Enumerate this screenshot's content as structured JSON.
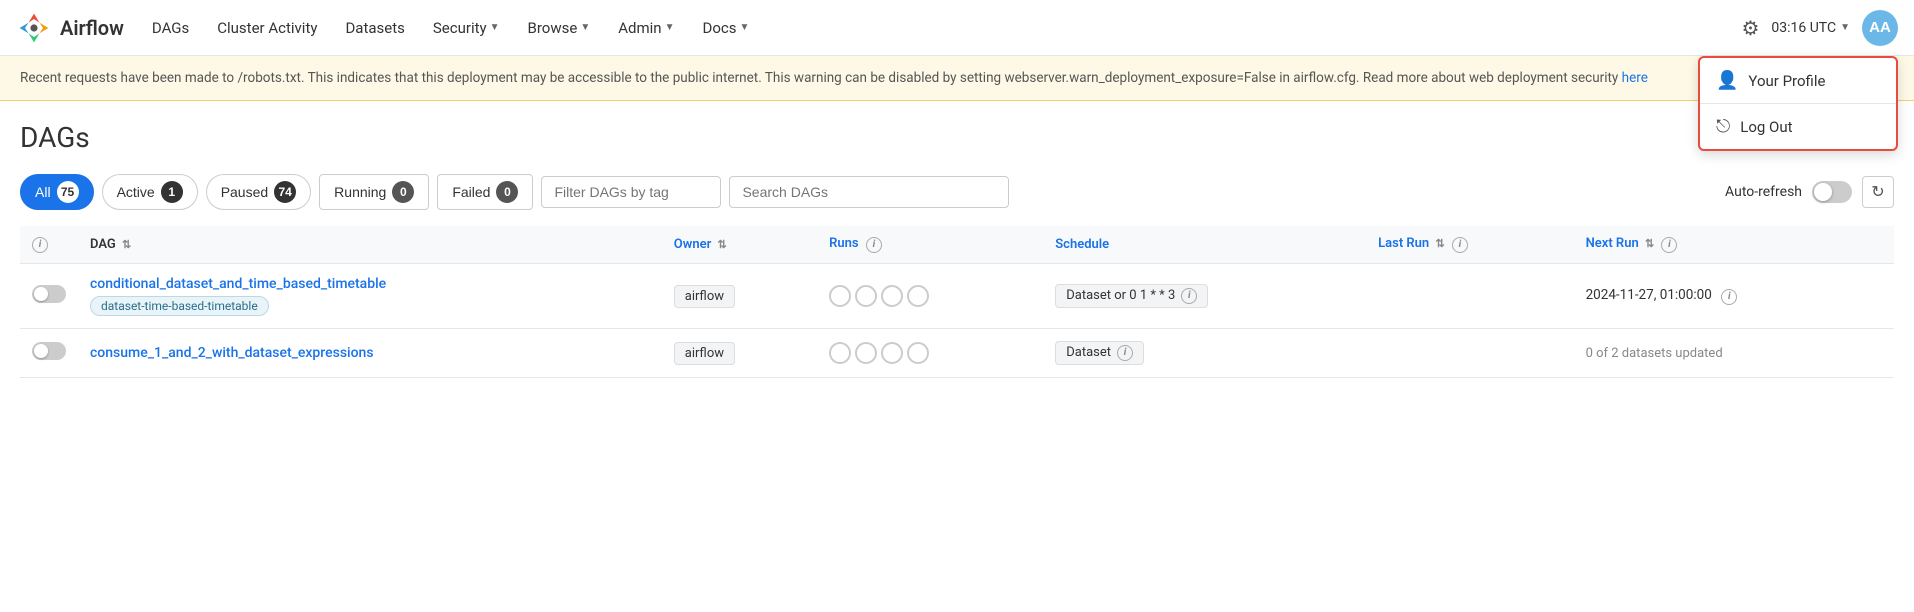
{
  "navbar": {
    "logo_text": "Airflow",
    "nav_items": [
      {
        "label": "DAGs",
        "has_dropdown": false
      },
      {
        "label": "Cluster Activity",
        "has_dropdown": false
      },
      {
        "label": "Datasets",
        "has_dropdown": false
      },
      {
        "label": "Security",
        "has_dropdown": true
      },
      {
        "label": "Browse",
        "has_dropdown": true
      },
      {
        "label": "Admin",
        "has_dropdown": true
      },
      {
        "label": "Docs",
        "has_dropdown": true
      }
    ],
    "time": "03:16 UTC",
    "avatar_initials": "AA"
  },
  "dropdown_menu": {
    "items": [
      {
        "label": "Your Profile",
        "icon": "person"
      },
      {
        "label": "Log Out",
        "icon": "logout"
      }
    ]
  },
  "warning_banner": {
    "text": "Recent requests have been made to /robots.txt. This indicates that this deployment may be accessible to the public internet. This warning can be disabled by setting webserver.warn_deployment_exposure=False in airflow.cfg. Read more about web deployment security ",
    "link_text": "here"
  },
  "page_title": "DAGs",
  "filters": {
    "all_label": "All",
    "all_count": "75",
    "active_label": "Active",
    "active_count": "1",
    "paused_label": "Paused",
    "paused_count": "74",
    "running_label": "Running",
    "running_count": "0",
    "failed_label": "Failed",
    "failed_count": "0",
    "tag_placeholder": "Filter DAGs by tag",
    "search_placeholder": "Search DAGs",
    "auto_refresh_label": "Auto-refresh"
  },
  "table": {
    "columns": [
      {
        "label": "DAG",
        "sortable": true,
        "info": false,
        "color": "black"
      },
      {
        "label": "Owner",
        "sortable": true,
        "info": false,
        "color": "blue"
      },
      {
        "label": "Runs",
        "sortable": false,
        "info": true,
        "color": "blue"
      },
      {
        "label": "Schedule",
        "sortable": false,
        "info": false,
        "color": "blue"
      },
      {
        "label": "Last Run",
        "sortable": true,
        "info": true,
        "color": "blue"
      },
      {
        "label": "Next Run",
        "sortable": true,
        "info": true,
        "color": "blue"
      }
    ],
    "rows": [
      {
        "name": "conditional_dataset_and_time_based_timetable",
        "tag": "dataset-time-based-timetable",
        "owner": "airflow",
        "runs": 4,
        "schedule": "Dataset or 0 1 * * 3",
        "last_run": "",
        "next_run": "2024-11-27, 01:00:00"
      },
      {
        "name": "consume_1_and_2_with_dataset_expressions",
        "tag": "",
        "owner": "airflow",
        "runs": 4,
        "schedule": "Dataset",
        "last_run": "",
        "next_run": "0 of 2 datasets updated"
      }
    ]
  }
}
